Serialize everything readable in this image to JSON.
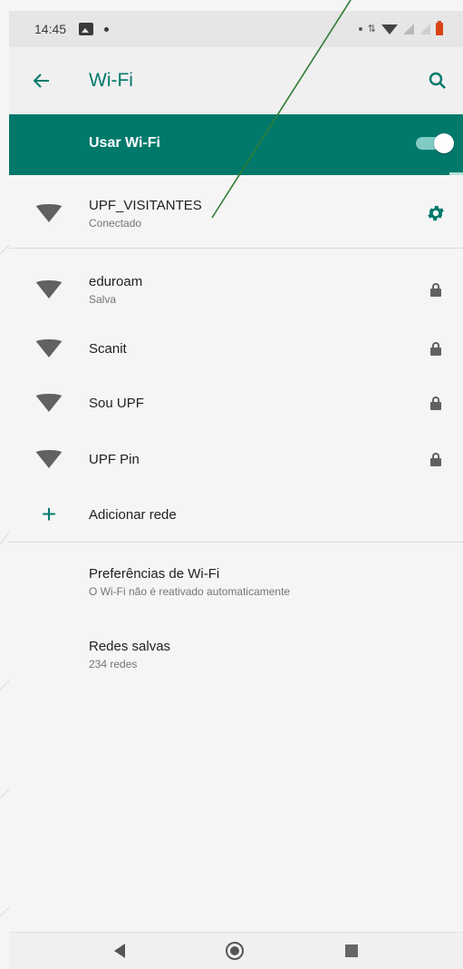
{
  "status_bar": {
    "time": "14:45"
  },
  "app_bar": {
    "title": "Wi-Fi",
    "back_icon": "arrow-back-icon",
    "search_icon": "search-icon"
  },
  "master_switch": {
    "label": "Usar Wi-Fi",
    "state": "on"
  },
  "connected_network": {
    "name": "UPF_VISITANTES",
    "status": "Conectado",
    "settings_icon": "gear-icon"
  },
  "networks": [
    {
      "name": "eduroam",
      "status": "Salva",
      "secured": true
    },
    {
      "name": "Scanit",
      "status": "",
      "secured": true
    },
    {
      "name": "Sou UPF",
      "status": "",
      "secured": true
    },
    {
      "name": "UPF Pin",
      "status": "",
      "secured": true
    }
  ],
  "add_network": {
    "label": "Adicionar rede"
  },
  "preferences": {
    "title": "Preferências de Wi-Fi",
    "subtitle": "O Wi-Fi não é reativado automaticamente"
  },
  "saved_networks": {
    "title": "Redes salvas",
    "subtitle": "234 redes"
  },
  "colors": {
    "accent": "#00796b",
    "annotation_line": "#2e7d32"
  }
}
